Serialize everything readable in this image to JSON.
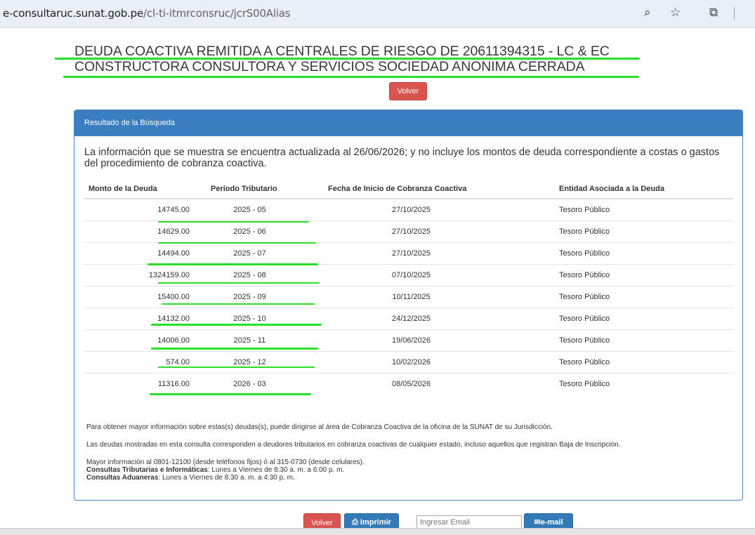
{
  "browser": {
    "url_host": "e-consultaruc.sunat.gob.pe",
    "url_path": "/cl-ti-itmrconsruc/jcrS00Alias",
    "zoom_icon": "zoom-icon",
    "star_icon": "bookmark-star-icon",
    "ext_icon": "extensions-icon"
  },
  "page": {
    "title": "DEUDA COACTIVA REMITIDA A CENTRALES DE RIESGO DE 20611394315 - LC & EC CONSTRUCTORA CONSULTORA Y SERVICIOS SOCIEDAD ANONIMA CERRADA",
    "volver_top": "Volver"
  },
  "panel": {
    "heading": "Resultado de la Búsqueda",
    "info": "La información que se muestra se encuentra actualizada al 26/06/2026; y no incluye los montos de deuda correspondiente a costas o gastos del procedimiento de cobranza coactiva.",
    "columns": [
      "Monto de la Deuda",
      "Período Tributario",
      "Fecha de Inicio de Cobranza Coactiva",
      "Entidad Asociada a la Deuda"
    ],
    "rows": [
      {
        "monto": "14745.00",
        "periodo": "2025 - 05",
        "fecha": "27/10/2025",
        "entidad": "Tesoro Público"
      },
      {
        "monto": "14629.00",
        "periodo": "2025 - 06",
        "fecha": "27/10/2025",
        "entidad": "Tesoro Público"
      },
      {
        "monto": "14494.00",
        "periodo": "2025 - 07",
        "fecha": "27/10/2025",
        "entidad": "Tesoro Público"
      },
      {
        "monto": "1324159.00",
        "periodo": "2025 - 08",
        "fecha": "07/10/2025",
        "entidad": "Tesoro Público"
      },
      {
        "monto": "15400.00",
        "periodo": "2025 - 09",
        "fecha": "10/11/2025",
        "entidad": "Tesoro Público"
      },
      {
        "monto": "14132.00",
        "periodo": "2025 - 10",
        "fecha": "24/12/2025",
        "entidad": "Tesoro Público"
      },
      {
        "monto": "14006.00",
        "periodo": "2025 - 11",
        "fecha": "19/06/2026",
        "entidad": "Tesoro Público"
      },
      {
        "monto": "574.00",
        "periodo": "2025 - 12",
        "fecha": "10/02/2026",
        "entidad": "Tesoro Público"
      },
      {
        "monto": "11316.00",
        "periodo": "2026 - 03",
        "fecha": "08/05/2026",
        "entidad": "Tesoro Público"
      }
    ],
    "note1": "Para obtener mayor información sobre estas(s) deudas(s), puede dirigirse al área de Cobranza Coactiva de la oficina de la SUNAT de su Jurisdicción.",
    "note2": "Las deudas mostradas en esta consulta corresponden a deudores tributarios en cobranza coactivas de cualquier estado, incluso aquellos que registran Baja de Inscripción.",
    "contact_line": "Mayor información al 0801-12100 (desde teléfonos fijos) ó al 315-0730 (desde celulares).",
    "tributarias_label": "Consultas Tributarias e Informáticas",
    "tributarias_hours": ": Lunes a Viernes de 8:30 a. m. a 6:00 p. m.",
    "aduaneras_label": "Consultas Aduaneras",
    "aduaneras_hours": ": Lunes a Viernes de 8:30 a. m. a 4:30 p. m."
  },
  "footer": {
    "volver": "Volver",
    "imprimir": "Imprimir",
    "email_placeholder": "Ingresar Email",
    "email_button": "e-mail"
  },
  "colors": {
    "panel_header": "#3a7ec0",
    "button_red": "#d9534f",
    "button_blue": "#337ab7",
    "highlight": "#28e028"
  }
}
